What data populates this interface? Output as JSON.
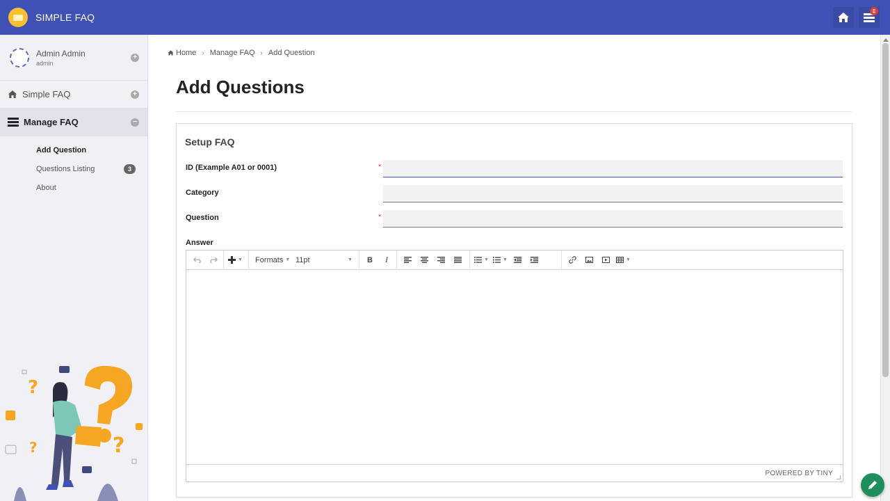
{
  "app": {
    "title": "SIMPLE FAQ",
    "notification_count": "0"
  },
  "user": {
    "name": "Admin Admin",
    "role": "admin"
  },
  "sidebar": {
    "items": [
      {
        "label": "Simple FAQ"
      },
      {
        "label": "Manage FAQ"
      }
    ],
    "sub_items": [
      {
        "label": "Add Question"
      },
      {
        "label": "Questions Listing",
        "badge": "3"
      },
      {
        "label": "About"
      }
    ]
  },
  "breadcrumb": [
    "Home",
    "Manage FAQ",
    "Add Question"
  ],
  "page": {
    "title": "Add Questions"
  },
  "form": {
    "title": "Setup FAQ",
    "fields": {
      "id": {
        "label": "ID (Example A01 or 0001)",
        "required_mark": "*",
        "value": ""
      },
      "category": {
        "label": "Category",
        "value": ""
      },
      "question": {
        "label": "Question",
        "required_mark": "*",
        "value": ""
      },
      "answer": {
        "label": "Answer"
      }
    },
    "editor": {
      "formats_label": "Formats",
      "font_size": "11pt",
      "bold_label": "B",
      "italic_label": "I",
      "powered_by": "POWERED BY TINY"
    }
  },
  "colors": {
    "primary": "#3f51b5",
    "fab": "#1e8e5c",
    "badge": "#e53935",
    "logo": "#fbc02d"
  }
}
